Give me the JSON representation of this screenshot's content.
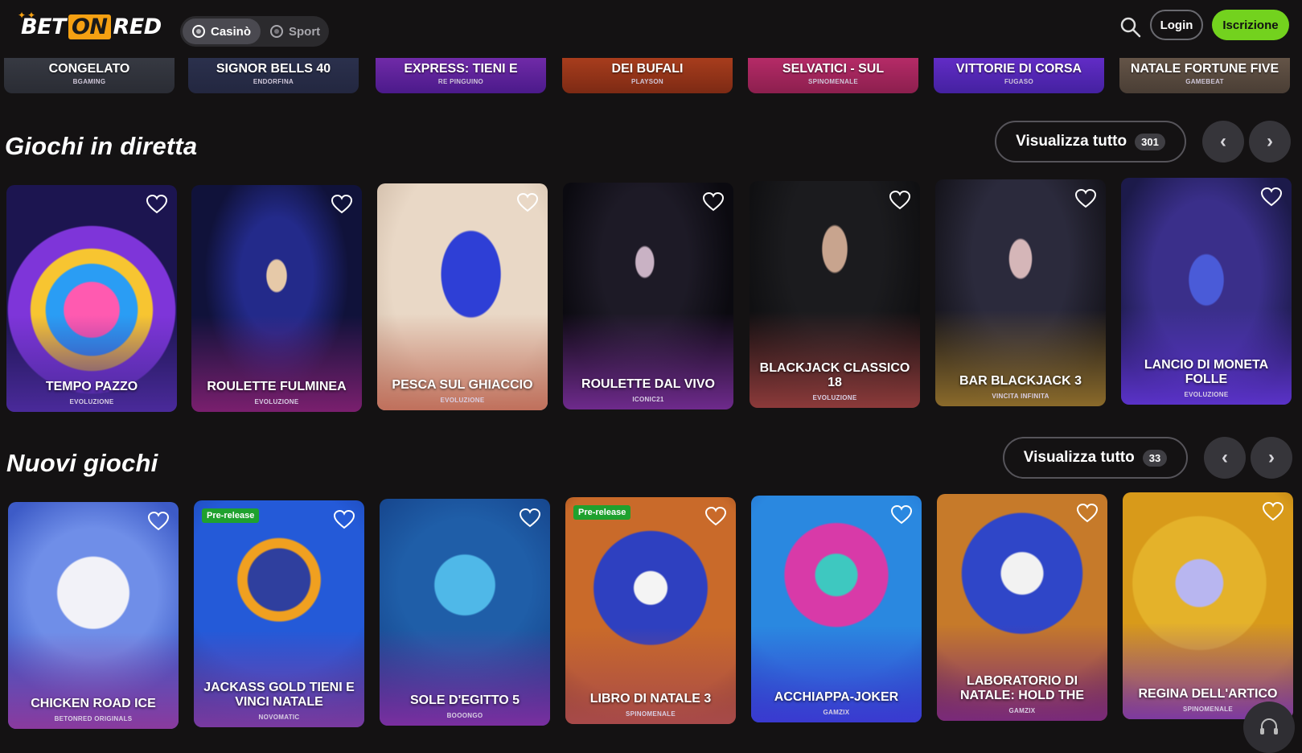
{
  "header": {
    "logo_bet": "BET",
    "logo_on": "ON",
    "logo_red": "RED",
    "tabs": [
      {
        "label": "Casinò",
        "active": true
      },
      {
        "label": "Sport",
        "active": false
      }
    ],
    "login_label": "Login",
    "signup_label": "Iscrizione"
  },
  "top_row": [
    {
      "title": "CONGELATO",
      "provider": "BGAMING"
    },
    {
      "title": "SIGNOR BELLS 40",
      "provider": "ENDORFINA"
    },
    {
      "title": "EXPRESS: TIENI E",
      "provider": "RE PINGUINO"
    },
    {
      "title": "DEI BUFALI",
      "provider": "PLAYSON"
    },
    {
      "title": "SELVATICI - SUL",
      "provider": "SPINOMENALE"
    },
    {
      "title": "VITTORIE DI CORSA",
      "provider": "FUGASO"
    },
    {
      "title": "NATALE FORTUNE FIVE",
      "provider": "GAMEBEAT"
    }
  ],
  "live": {
    "title": "Giochi in diretta",
    "view_all": "Visualizza tutto",
    "count": "301",
    "games": [
      {
        "title": "TEMPO PAZZO",
        "provider": "EVOLUZIONE"
      },
      {
        "title": "ROULETTE FULMINEA",
        "provider": "EVOLUZIONE"
      },
      {
        "title": "PESCA SUL GHIACCIO",
        "provider": "EVOLUZIONE"
      },
      {
        "title": "ROULETTE DAL VIVO",
        "provider": "ICONIC21"
      },
      {
        "title": "BLACKJACK CLASSICO 18",
        "provider": "EVOLUZIONE"
      },
      {
        "title": "BAR BLACKJACK 3",
        "provider": "VINCITA INFINITA"
      },
      {
        "title": "LANCIO DI MONETA FOLLE",
        "provider": "EVOLUZIONE"
      }
    ]
  },
  "new": {
    "title": "Nuovi giochi",
    "view_all": "Visualizza tutto",
    "count": "33",
    "pre_release_label": "Pre-release",
    "games": [
      {
        "title": "CHICKEN ROAD ICE",
        "provider": "BETONRED ORIGINALS"
      },
      {
        "title": "JACKASS GOLD TIENI E VINCI NATALE",
        "provider": "NOVOMATIC"
      },
      {
        "title": "SOLE D'EGITTO 5",
        "provider": "BOOONGO"
      },
      {
        "title": "LIBRO DI NATALE 3",
        "provider": "SPINOMENALE"
      },
      {
        "title": "ACCHIAPPA-JOKER",
        "provider": "GAMZIX"
      },
      {
        "title": "LABORATORIO DI NATALE: HOLD THE",
        "provider": "GAMZIX"
      },
      {
        "title": "REGINA DELL'ARTICO",
        "provider": "SPINOMENALE"
      }
    ]
  },
  "colors": {
    "accent_green": "#73d21e",
    "logo_orange": "#f5a012",
    "background": "#141213"
  }
}
